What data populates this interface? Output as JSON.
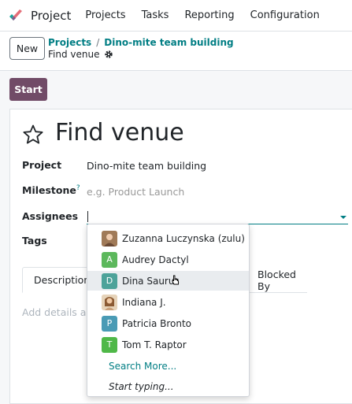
{
  "navbar": {
    "app_name": "Project",
    "menu": [
      "Projects",
      "Tasks",
      "Reporting",
      "Configuration"
    ]
  },
  "control": {
    "new_label": "New",
    "breadcrumb": [
      "Projects",
      "Dino-mite team building"
    ],
    "breadcrumb_separator": "/",
    "current": "Find venue"
  },
  "status": {
    "start_label": "Start"
  },
  "form": {
    "title": "Find venue",
    "fields": {
      "project_label": "Project",
      "project_value": "Dino-mite team building",
      "milestone_label": "Milestone",
      "milestone_help": "?",
      "milestone_placeholder": "e.g. Product Launch",
      "assignees_label": "Assignees",
      "tags_label": "Tags"
    },
    "tabs": [
      "Description",
      "Blocked By"
    ],
    "description_placeholder": "Add details abo"
  },
  "dropdown": {
    "items": [
      {
        "name": "Zuzanna Luczynska (zulu)",
        "avatar": "photo",
        "color": "#c8a27a"
      },
      {
        "name": "Audrey Dactyl",
        "avatar": "A",
        "color": "#5cb85c"
      },
      {
        "name": "Dina Saurus",
        "avatar": "D",
        "color": "#4da39a"
      },
      {
        "name": "Indiana J.",
        "avatar": "photo",
        "color": "#b07a4f"
      },
      {
        "name": "Patricia Bronto",
        "avatar": "P",
        "color": "#4a9bb5"
      },
      {
        "name": "Tom T. Raptor",
        "avatar": "T",
        "color": "#4fb848"
      }
    ],
    "search_more": "Search More...",
    "start_typing": "Start typing..."
  },
  "colors": {
    "brand": "#714b67",
    "accent": "#017e84"
  }
}
